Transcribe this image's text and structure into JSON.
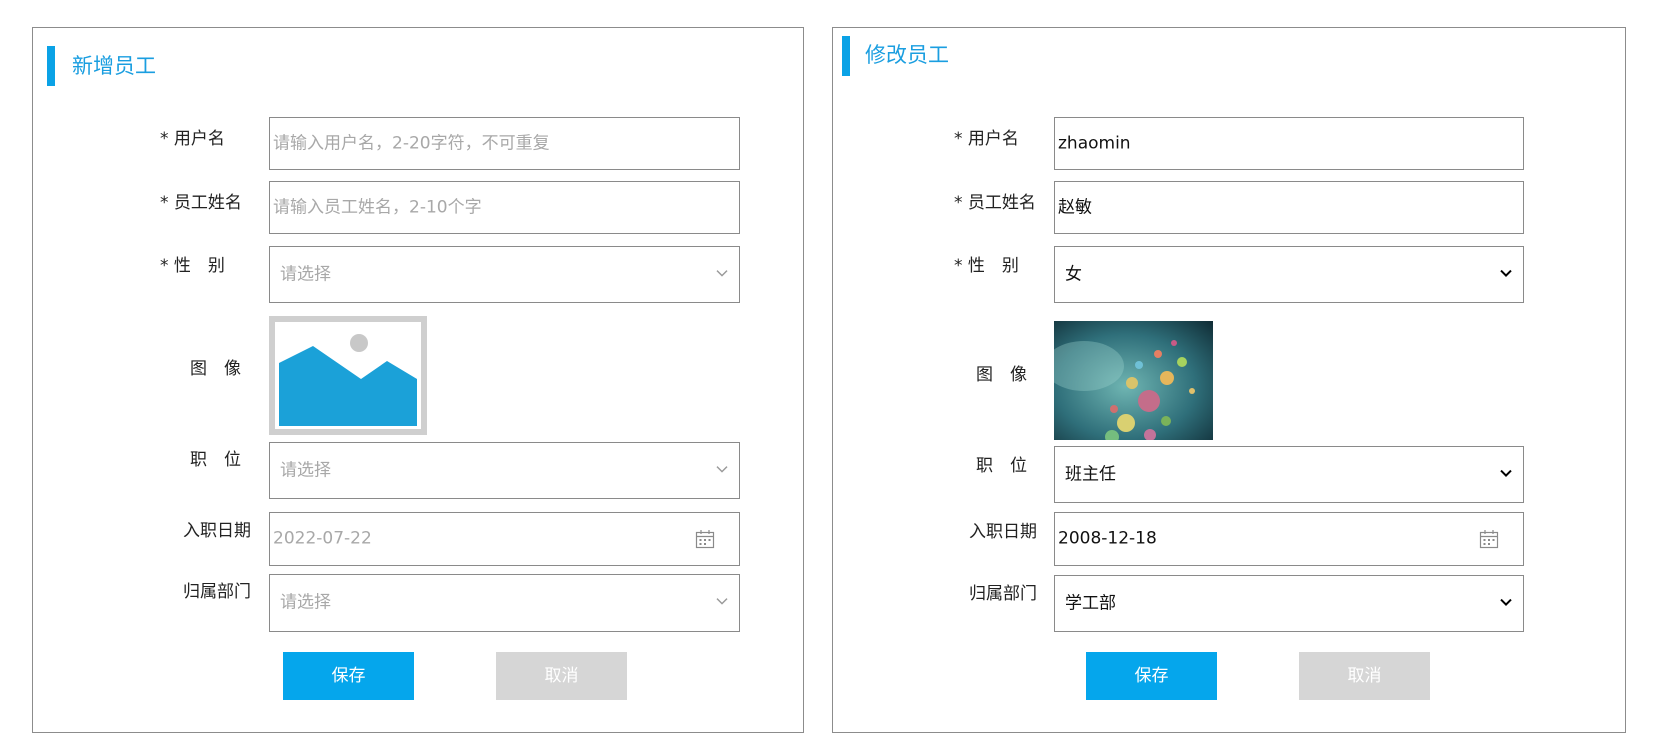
{
  "add_form": {
    "title": "新增员工",
    "labels": {
      "username": "* 用户名",
      "name": "* 员工姓名",
      "gender": "* 性　别",
      "image": "图　像",
      "position": "职　位",
      "entry_date": "入职日期",
      "department": "归属部门"
    },
    "username_placeholder": "请输入用户名，2-20字符，不可重复",
    "name_placeholder": "请输入员工姓名，2-10个字",
    "gender_placeholder": "请选择",
    "position_placeholder": "请选择",
    "entry_date_value": "2022-07-22",
    "department_placeholder": "请选择",
    "save_label": "保存",
    "cancel_label": "取消"
  },
  "edit_form": {
    "title": "修改员工",
    "labels": {
      "username": "* 用户名",
      "name": "* 员工姓名",
      "gender": "* 性　别",
      "image": "图　像",
      "position": "职　位",
      "entry_date": "入职日期",
      "department": "归属部门"
    },
    "username_value": "zhaomin",
    "name_value": "赵敏",
    "gender_value": "女",
    "position_value": "班主任",
    "entry_date_value": "2008-12-18",
    "department_value": "学工部",
    "save_label": "保存",
    "cancel_label": "取消"
  },
  "colors": {
    "accent": "#05a6ec",
    "title_text": "#1a9ee0",
    "disabled_button": "#d6d6d6",
    "placeholder_text": "#a8a8a8",
    "image_placeholder_fill": "#1ba1d8"
  },
  "icons": {
    "dropdown": "chevron-down-icon",
    "date": "calendar-icon",
    "image_placeholder": "image-placeholder-icon"
  }
}
